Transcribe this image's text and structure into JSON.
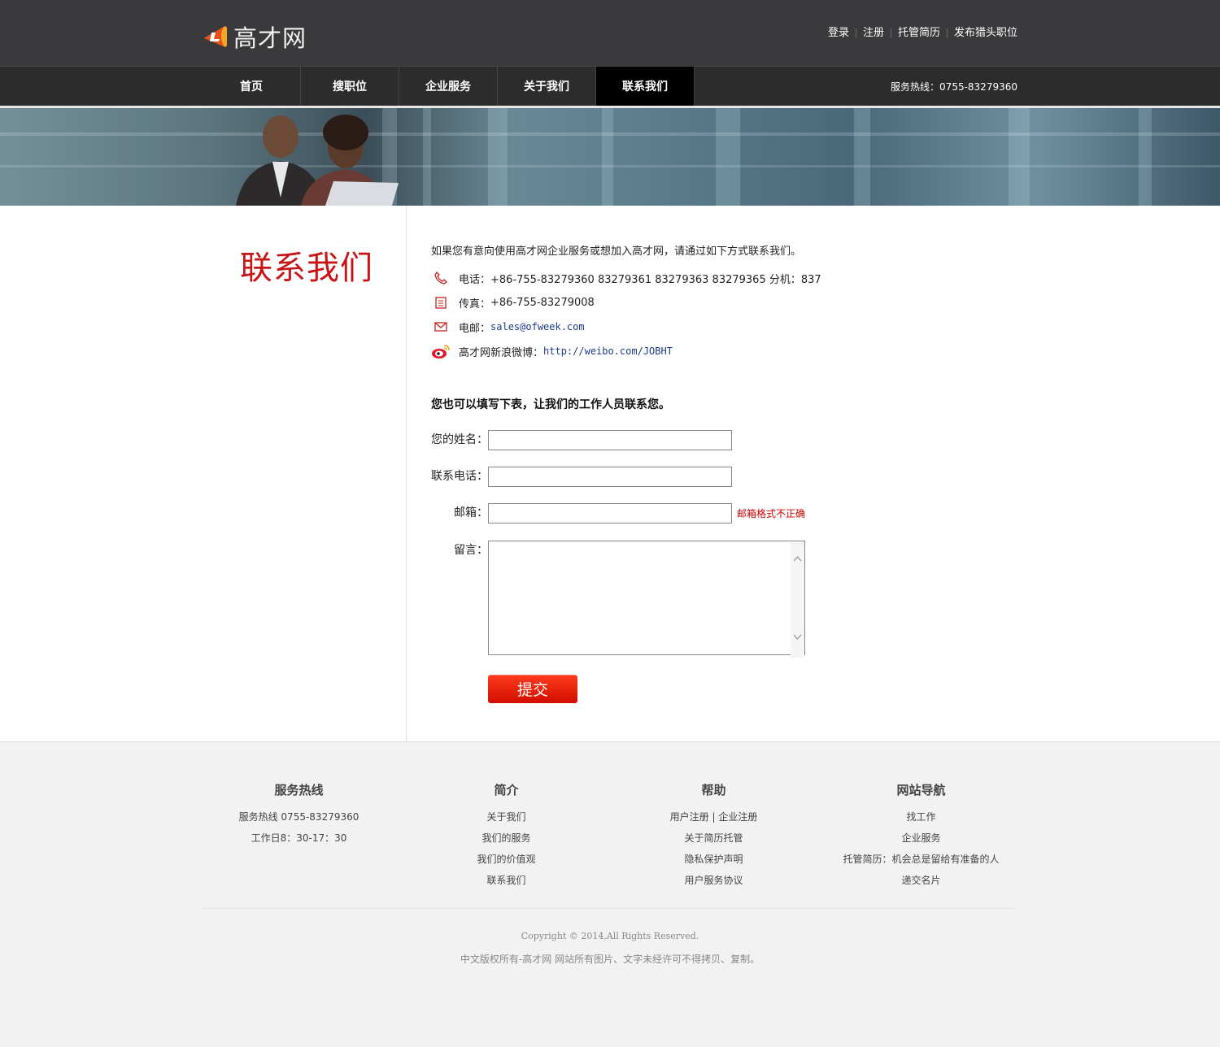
{
  "header": {
    "site_name": "高才网",
    "top_links": [
      "登录",
      "注册",
      "托管简历",
      "发布猎头职位"
    ]
  },
  "nav": {
    "items": [
      "首页",
      "搜职位",
      "企业服务",
      "关于我们",
      "联系我们"
    ],
    "active": "联系我们",
    "hotline": "服务热线：0755-83279360"
  },
  "page": {
    "title": "联系我们",
    "intro": "如果您有意向使用高才网企业服务或想加入高才网，请通过如下方式联系我们。",
    "contacts": {
      "phone_label": "电话：",
      "phone_value": "+86-755-83279360 83279361 83279363 83279365 分机：837",
      "fax_label": "传真：",
      "fax_value": "+86-755-83279008",
      "email_label": "电邮：",
      "email_value": "sales@ofweek.com",
      "weibo_label": "高才网新浪微博：",
      "weibo_value": "http://weibo.com/JOBHT"
    },
    "form": {
      "title": "您也可以填写下表，让我们的工作人员联系您。",
      "name_label": "您的姓名：",
      "phone_label": "联系电话：",
      "email_label": "邮箱：",
      "email_error": "邮箱格式不正确",
      "message_label": "留言：",
      "submit_label": "提交",
      "name_value": "",
      "phone_value": "",
      "email_value": "",
      "message_value": ""
    }
  },
  "footer": {
    "columns": [
      {
        "title": "服务热线",
        "lines": [
          "服务热线 0755-83279360",
          "工作日8：30-17：30"
        ]
      },
      {
        "title": "简介",
        "lines": [
          "关于我们",
          "我们的服务",
          "我们的价值观",
          "联系我们"
        ]
      },
      {
        "title": "帮助",
        "lines": [
          "用户注册 | 企业注册",
          "关于简历托管",
          "隐私保护声明",
          "用户服务协议"
        ]
      },
      {
        "title": "网站导航",
        "lines": [
          "找工作",
          "企业服务",
          "托管简历：机会总是留给有准备的人",
          "递交名片"
        ]
      }
    ],
    "copyright": "Copyright © 2014,All Rights Reserved.",
    "notice": "中文版权所有-高才网 网站所有图片、文字未经许可不得拷贝、复制。"
  },
  "colors": {
    "header_bg": "#3a3a3c",
    "nav_bg": "#2c2c2c",
    "nav_active": "#000000",
    "title_red": "#c81414",
    "link_blue": "#1a3c8c",
    "submit_red": "#e01a0a"
  }
}
